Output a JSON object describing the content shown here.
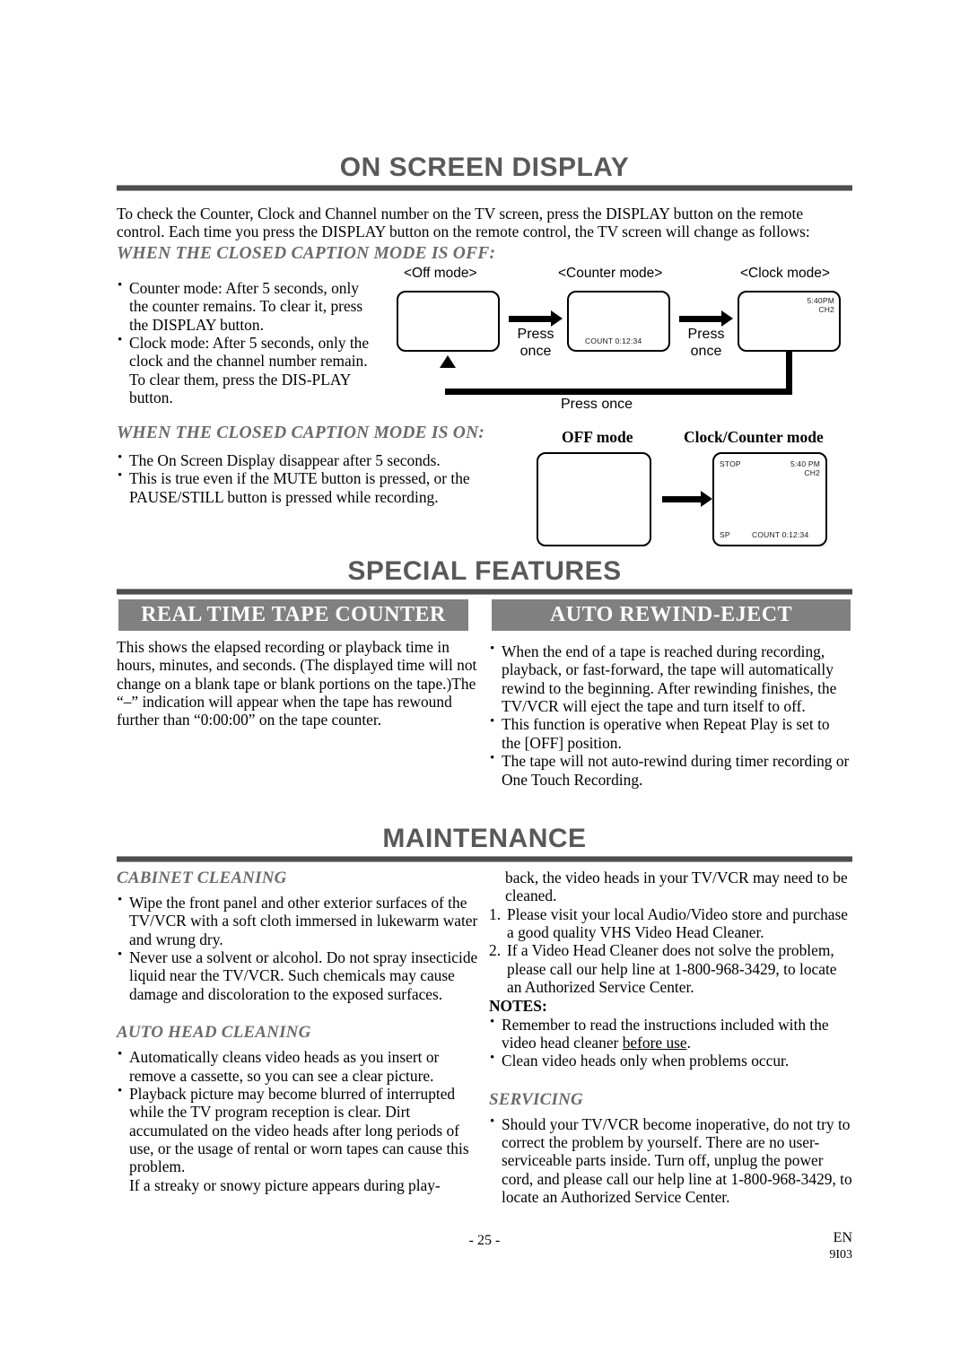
{
  "sections": {
    "osd": {
      "title": "ON SCREEN DISPLAY",
      "intro": "To check the Counter, Clock and Channel number on the TV screen, press the DISPLAY button on the remote control. Each time you press the DISPLAY button on the remote control, the TV screen will change as follows:",
      "cc_off_head": "WHEN THE CLOSED CAPTION MODE IS OFF:",
      "cc_off_bullets": [
        "Counter mode: After 5 seconds, only the counter remains. To clear it, press the DISPLAY button.",
        "Clock mode: After 5 seconds, only the clock and the channel number remain. To clear them, press the DIS-PLAY button."
      ],
      "cc_on_head": "WHEN THE CLOSED CAPTION MODE IS ON:",
      "cc_on_bullets": [
        "The On Screen Display disappear after 5 seconds.",
        "This is true even if the MUTE button is pressed, or the PAUSE/STILL button is pressed while recording."
      ],
      "diagram_off": {
        "label_off": "<Off mode>",
        "label_counter": "<Counter mode>",
        "label_clock": "<Clock mode>",
        "press1": "Press\nonce",
        "press2": "Press\nonce",
        "press_loop": "Press once",
        "counter_osd": "COUNT  0:12:34",
        "clock_osd_time": "5:40PM",
        "clock_osd_ch": "CH2"
      },
      "diagram_on": {
        "label_off": "OFF mode",
        "label_clockcounter": "Clock/Counter mode",
        "osd_stop": "STOP",
        "osd_time": "5:40 PM",
        "osd_ch": "CH2",
        "osd_sp": "SP",
        "osd_count": "COUNT  0:12:34"
      }
    },
    "special_features": {
      "title": "SPECIAL FEATURES",
      "left_banner": "REAL TIME TAPE COUNTER",
      "right_banner": "AUTO REWIND-EJECT",
      "left_body": "This shows the elapsed recording or playback time in hours, minutes, and seconds. (The displayed time will not change on a blank tape or blank portions on the tape.)The “–” indication will appear when the tape has rewound further than “0:00:00” on the tape counter.",
      "right_bullets": [
        "When the end of a tape is reached during recording, playback, or fast-forward, the tape will automatically rewind to the beginning. After rewinding finishes, the TV/VCR will eject the tape and turn itself to off.",
        "This function is operative when Repeat Play is set to the [OFF] position.",
        "The tape will not auto-rewind during timer recording or One Touch Recording."
      ]
    },
    "maintenance": {
      "title": "MAINTENANCE",
      "cabinet_head": "CABINET CLEANING",
      "cabinet_bullets": [
        "Wipe the front panel and other exterior surfaces of the TV/VCR with a soft cloth immersed in lukewarm water and wrung dry.",
        "Never use a solvent or alcohol. Do not spray insecticide liquid near the TV/VCR. Such chemicals may cause damage and discoloration to the exposed surfaces."
      ],
      "auto_head_head": "AUTO HEAD CLEANING",
      "auto_head_bullets": [
        "Automatically cleans video heads as you insert or remove a cassette, so you can see a clear picture.",
        "Playback picture may become blurred of interrupted while the TV program reception is clear. Dirt accumulated on the video heads after long periods of use, or the usage of rental or worn tapes can cause this problem."
      ],
      "auto_head_tail": "If a streaky or snowy picture appears during play-",
      "right_continuation": "back, the video heads in your TV/VCR may need to be cleaned.",
      "numbered": [
        "Please visit your local Audio/Video store and purchase a good quality VHS Video Head Cleaner.",
        "If a Video Head Cleaner does not solve the problem, please call our help line at 1-800-968-3429, to locate an Authorized Service Center."
      ],
      "notes_label": "NOTES:",
      "notes_bullet_1_pre": "Remember to read the instructions included with the video head cleaner ",
      "notes_bullet_1_underline": "before use",
      "notes_bullet_1_post": ".",
      "notes_bullet_2": "Clean video heads only when problems occur.",
      "servicing_head": "SERVICING",
      "servicing_bullets": [
        "Should your TV/VCR become inoperative, do not try to correct the problem by yourself. There are no user-serviceable parts inside. Turn off, unplug the power cord, and please call our help line at 1-800-968-3429, to locate an Authorized Service Center."
      ]
    }
  },
  "footer": {
    "page_number": "- 25 -",
    "lang": "EN",
    "code": "9I03"
  },
  "colors": {
    "banner_gray": "#808080",
    "title_gray": "#595959",
    "subhead_gray": "#6b6b6b",
    "rule_dark": "#4d4d4d"
  }
}
